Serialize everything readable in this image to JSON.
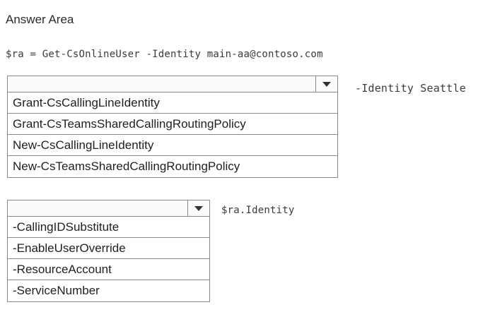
{
  "header": {
    "title": "Answer Area"
  },
  "code": {
    "line1": "$ra = Get-CsOnlineUser -Identity main-aa@contoso.com",
    "suffix1": "-Identity Seattle",
    "suffix2": "$ra.Identity"
  },
  "dropdown1": {
    "options": [
      "Grant-CsCallingLineIdentity",
      "Grant-CsTeamsSharedCallingRoutingPolicy",
      "New-CsCallingLineIdentity",
      "New-CsTeamsSharedCallingRoutingPolicy"
    ]
  },
  "dropdown2": {
    "options": [
      "-CallingIDSubstitute",
      "-EnableUserOverride",
      "-ResourceAccount",
      "-ServiceNumber"
    ]
  },
  "icons": {
    "arrow": "chevron-down-icon"
  }
}
